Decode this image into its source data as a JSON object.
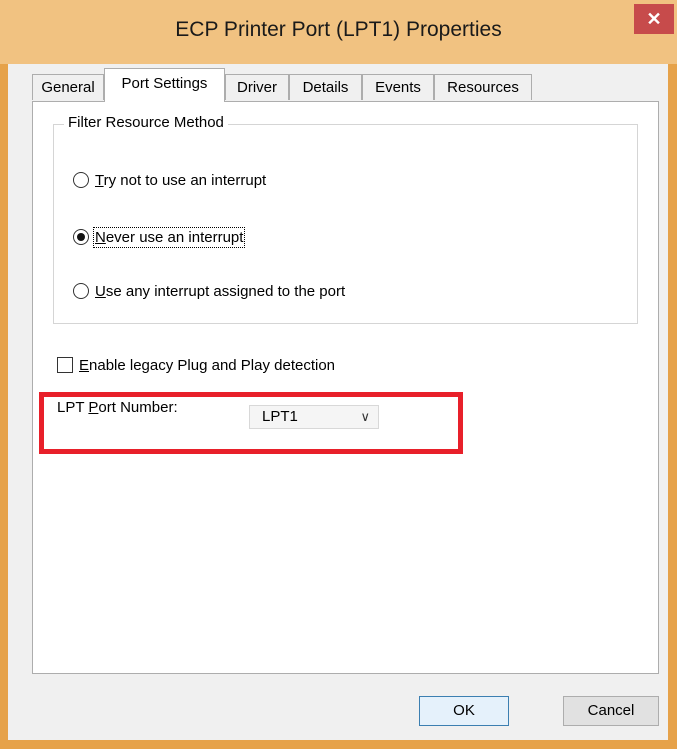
{
  "window": {
    "title": "ECP Printer Port (LPT1) Properties",
    "close_symbol": "✕"
  },
  "tabs": [
    {
      "label": "General"
    },
    {
      "label": "Port Settings"
    },
    {
      "label": "Driver"
    },
    {
      "label": "Details"
    },
    {
      "label": "Events"
    },
    {
      "label": "Resources"
    }
  ],
  "active_tab": "Port Settings",
  "filter_group": {
    "label": "Filter Resource Method",
    "options": [
      {
        "accel": "T",
        "rest": "ry not to use an interrupt",
        "checked": false
      },
      {
        "accel": "N",
        "rest": "ever use an interrupt",
        "checked": true
      },
      {
        "accel": "U",
        "rest": "se any interrupt assigned to the port",
        "checked": false
      }
    ]
  },
  "legacy_checkbox": {
    "accel": "E",
    "rest": "nable legacy Plug and Play detection",
    "checked": false
  },
  "port_number": {
    "label_pre": "LPT ",
    "label_accel": "P",
    "label_post": "ort Number:",
    "value": "LPT1"
  },
  "buttons": {
    "ok": "OK",
    "cancel": "Cancel"
  },
  "colors": {
    "highlight_box": "#e8202a",
    "title_bar": "#f1c281",
    "close_button": "#c74b4b"
  }
}
